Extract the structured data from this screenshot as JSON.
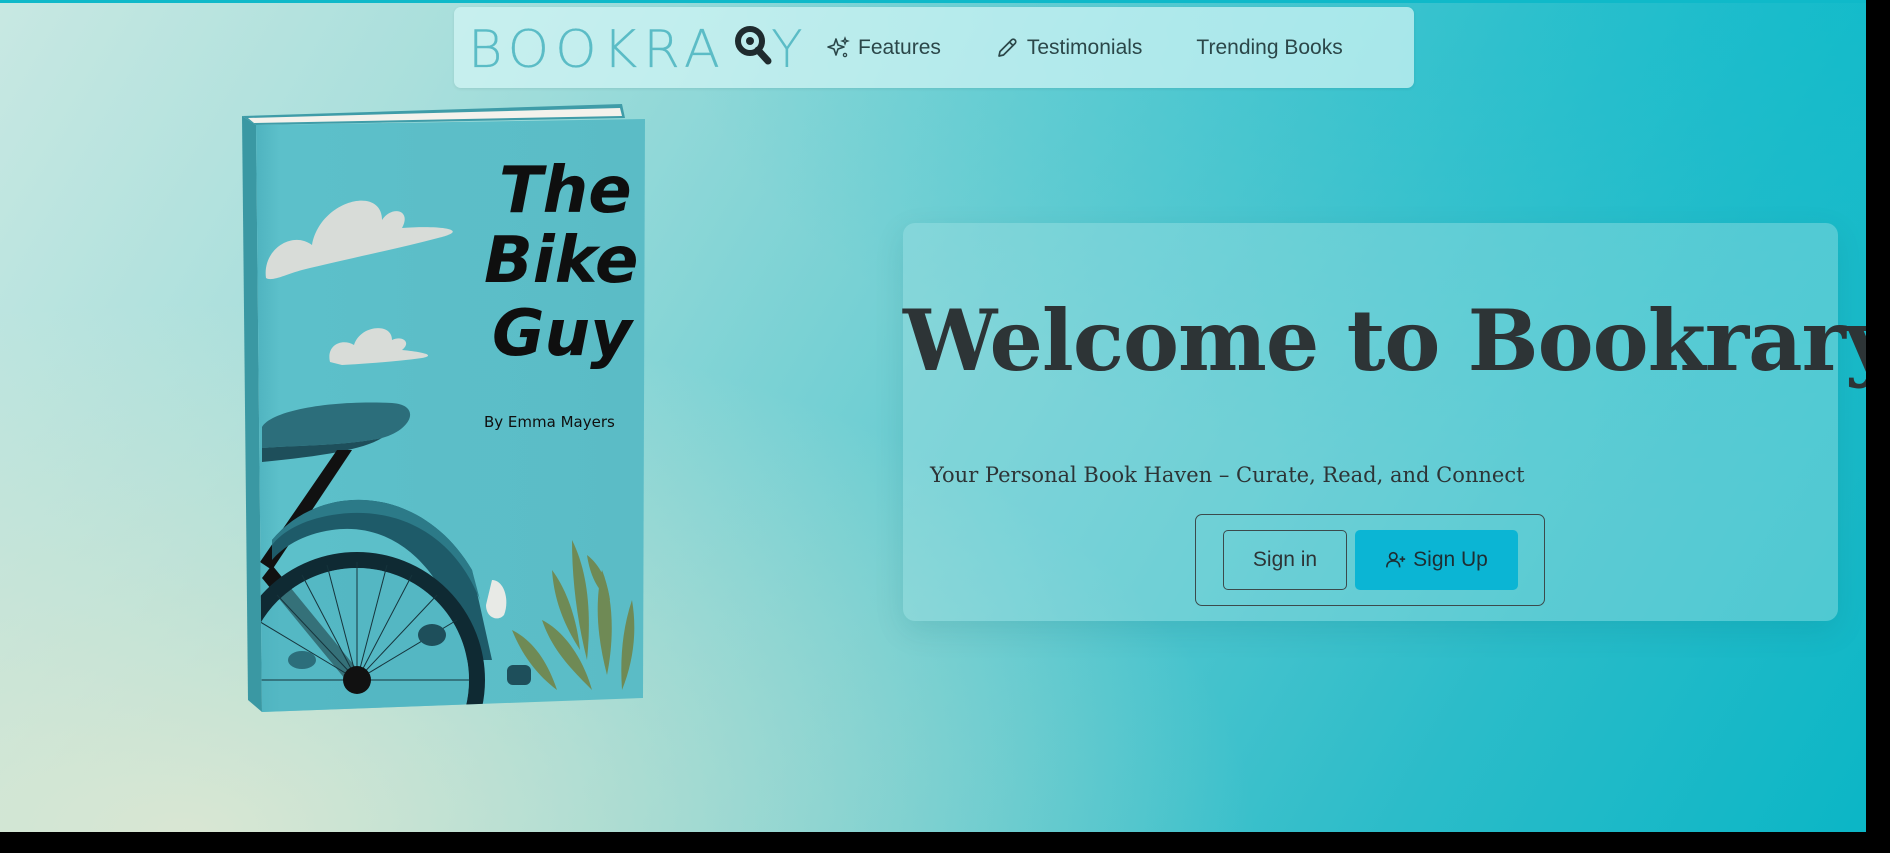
{
  "brand": {
    "logo_text": "BOOKRARY",
    "logo_prefix": "BOOKRA",
    "logo_suffix": "Y"
  },
  "nav": {
    "items": [
      {
        "label": "Features",
        "icon": "sparkles-icon"
      },
      {
        "label": "Testimonials",
        "icon": "pencil-icon"
      },
      {
        "label": "Trending Books",
        "icon": ""
      }
    ]
  },
  "book": {
    "title_line1": "The",
    "title_line2": "Bike",
    "title_line3": "Guy",
    "author": "By Emma Mayers"
  },
  "hero": {
    "heading": "Welcome to Bookrary",
    "tagline": "Your Personal Book Haven – Curate, Read, and Connect",
    "signin_label": "Sign in",
    "signup_label": "Sign Up"
  },
  "colors": {
    "accent": "#0bb5d4",
    "text_dark": "#2d3436",
    "logo": "#5bbcc6"
  }
}
